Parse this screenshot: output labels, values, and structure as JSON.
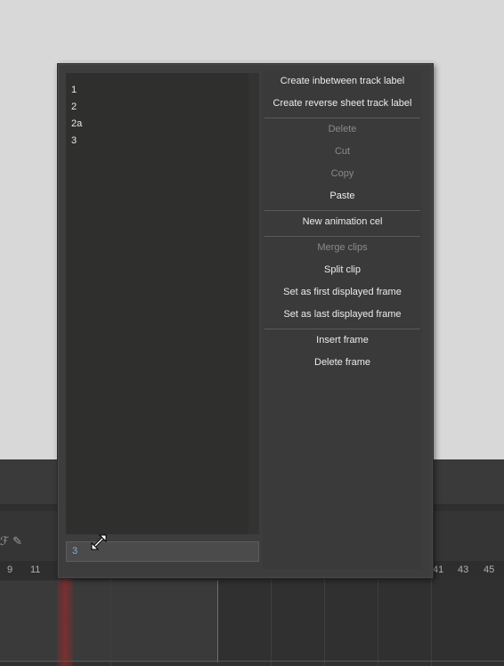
{
  "popup": {
    "labels": [
      "1",
      "2",
      "2a",
      "3"
    ],
    "input_value": "3",
    "menu": [
      {
        "label": "Create inbetween track label",
        "enabled": true
      },
      {
        "label": "Create reverse sheet track label",
        "enabled": true
      },
      {
        "label": "Delete",
        "enabled": false
      },
      {
        "label": "Cut",
        "enabled": false
      },
      {
        "label": "Copy",
        "enabled": false
      },
      {
        "label": "Paste",
        "enabled": true
      },
      {
        "label": "New animation cel",
        "enabled": true
      },
      {
        "label": "Merge clips",
        "enabled": false
      },
      {
        "label": "Split clip",
        "enabled": true
      },
      {
        "label": "Set as first displayed frame",
        "enabled": true
      },
      {
        "label": "Set as last displayed frame",
        "enabled": true
      },
      {
        "label": "Insert frame",
        "enabled": true
      },
      {
        "label": "Delete frame",
        "enabled": true
      }
    ]
  },
  "timeline": {
    "ruler_left": [
      "9",
      "11"
    ],
    "ruler_right": [
      "41",
      "43",
      "45"
    ]
  },
  "colors": {
    "popup_bg": "#3d3d3d",
    "list_bg": "#2f2f2e",
    "text": "#ececec",
    "disabled_text": "#8a8a8a",
    "input_text": "#8ea6e0",
    "playhead": "#a52a2a"
  },
  "icons": {
    "cursor": "resize-diagonal-icon",
    "tool_a": "fx-icon",
    "tool_b": "pencil-icon"
  }
}
